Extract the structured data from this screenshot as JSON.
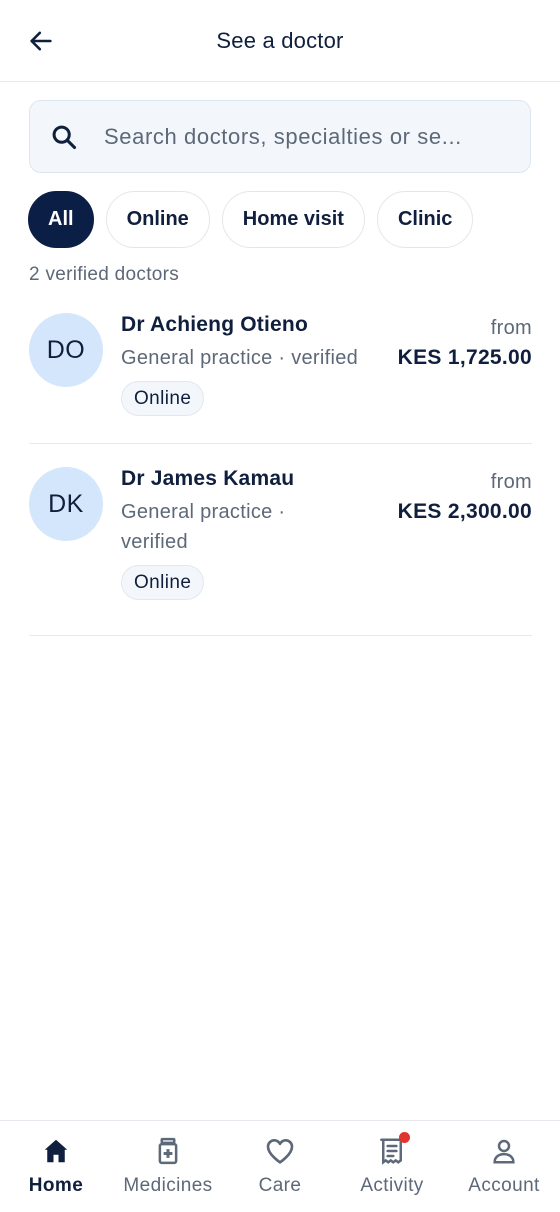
{
  "header": {
    "title": "See a doctor",
    "back_icon": "arrow-left-icon"
  },
  "search": {
    "placeholder": "Search doctors, specialties or se...",
    "value": "",
    "icon": "search-icon"
  },
  "filters": [
    {
      "label": "All",
      "active": true
    },
    {
      "label": "Online",
      "active": false
    },
    {
      "label": "Home visit",
      "active": false
    },
    {
      "label": "Clinic",
      "active": false
    }
  ],
  "results_count_label": "2 verified doctors",
  "doctors": [
    {
      "initials": "DO",
      "name": "Dr Achieng Otieno",
      "meta": "General practice · verified",
      "mode": "Online",
      "price_prefix": "from",
      "price": "KES 1,725.00"
    },
    {
      "initials": "DK",
      "name": "Dr James Kamau",
      "meta": "General practice · verified",
      "mode": "Online",
      "price_prefix": "from",
      "price": "KES 2,300.00"
    }
  ],
  "bottom_nav": [
    {
      "label": "Home",
      "icon": "home-icon",
      "active": true
    },
    {
      "label": "Medicines",
      "icon": "medicine-icon",
      "active": false
    },
    {
      "label": "Care",
      "icon": "heart-icon",
      "active": false
    },
    {
      "label": "Activity",
      "icon": "receipt-icon",
      "active": false,
      "notification": true
    },
    {
      "label": "Account",
      "icon": "user-icon",
      "active": false
    }
  ],
  "colors": {
    "primary": "#0b1e45",
    "text": "#0f1f3d",
    "muted": "#5d6878",
    "avatar_bg": "#d4e6fb",
    "search_bg": "#f3f7fb",
    "notification": "#e0342f"
  }
}
